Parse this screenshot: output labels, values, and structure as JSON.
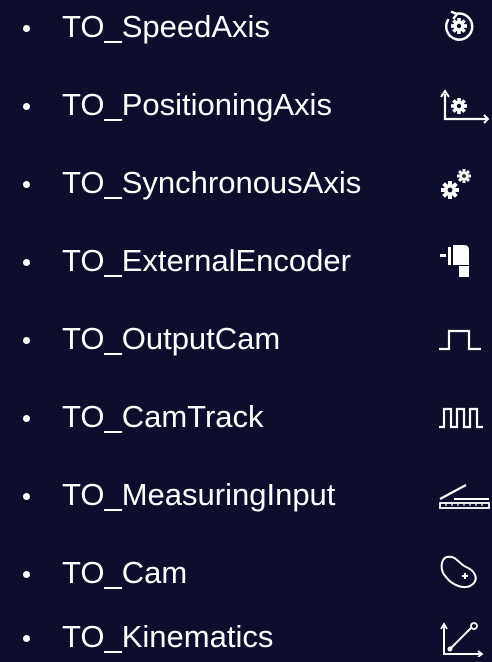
{
  "colors": {
    "background": "#0d0d2e",
    "text": "#ffffff"
  },
  "items": [
    {
      "label": "TO_SpeedAxis",
      "icon": "speed-axis-icon"
    },
    {
      "label": "TO_PositioningAxis",
      "icon": "positioning-axis-icon"
    },
    {
      "label": "TO_SynchronousAxis",
      "icon": "synchronous-axis-icon"
    },
    {
      "label": "TO_ExternalEncoder",
      "icon": "external-encoder-icon"
    },
    {
      "label": "TO_OutputCam",
      "icon": "output-cam-icon"
    },
    {
      "label": "TO_CamTrack",
      "icon": "cam-track-icon"
    },
    {
      "label": "TO_MeasuringInput",
      "icon": "measuring-input-icon"
    },
    {
      "label": "TO_Cam",
      "icon": "cam-icon"
    },
    {
      "label": "TO_Kinematics",
      "icon": "kinematics-icon"
    }
  ]
}
